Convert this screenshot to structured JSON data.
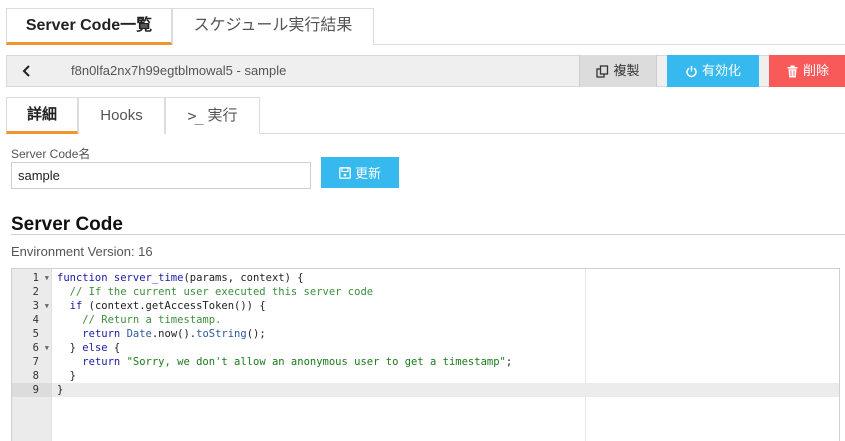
{
  "top_tabs": [
    {
      "label": "Server Code一覧",
      "active": true
    },
    {
      "label": "スケジュール実行結果",
      "active": false
    }
  ],
  "toolbar": {
    "record_title": "f8n0lfa2nx7h99egtblmowal5 - sample",
    "copy_label": "複製",
    "enable_label": "有効化",
    "delete_label": "削除"
  },
  "sub_tabs": [
    {
      "label": "詳細",
      "active": true
    },
    {
      "label": "Hooks",
      "active": false
    },
    {
      "label": "実行",
      "active": false
    }
  ],
  "form": {
    "name_label": "Server Code名",
    "name_value": "sample",
    "update_label": "更新"
  },
  "section": {
    "title": "Server Code",
    "env_version": "Environment Version: 16"
  },
  "code_lines": [
    {
      "n": "1",
      "fold": true,
      "text": "function server_time(params, context) {"
    },
    {
      "n": "2",
      "fold": false,
      "text": "  // If the current user executed this server code"
    },
    {
      "n": "3",
      "fold": true,
      "text": "  if (context.getAccessToken()) {"
    },
    {
      "n": "4",
      "fold": false,
      "text": "    // Return a timestamp."
    },
    {
      "n": "5",
      "fold": false,
      "text": "    return Date.now().toString();"
    },
    {
      "n": "6",
      "fold": true,
      "text": "  } else {"
    },
    {
      "n": "7",
      "fold": false,
      "text": "    return \"Sorry, we don't allow an anonymous user to get a timestamp\";"
    },
    {
      "n": "8",
      "fold": false,
      "text": "  }"
    },
    {
      "n": "9",
      "fold": false,
      "text": "}"
    }
  ],
  "colors": {
    "accent_tab": "#f0962c",
    "primary": "#36b9ef",
    "danger": "#f85a5a"
  }
}
